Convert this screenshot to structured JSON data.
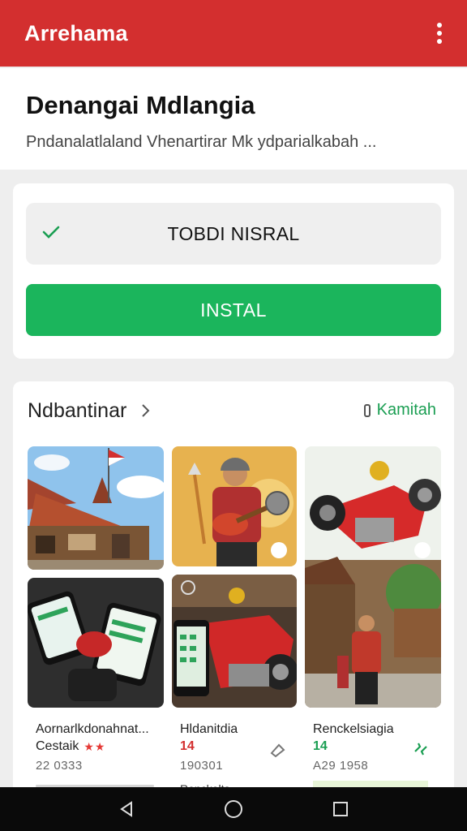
{
  "appbar": {
    "title": "Arrehama",
    "menu_icon": "more-vert-icon",
    "color": "#d32f2f"
  },
  "header": {
    "title": "Denangai Mdlangia",
    "subtitle": "Pndanalatlaland Vhenartirar Mk ydparialkabah ..."
  },
  "install_card": {
    "status_icon": "check-icon",
    "status_text": "TOBDI NISRAL",
    "install_label": "INSTAL",
    "install_color": "#1bb55c"
  },
  "gallery": {
    "title": "Ndbantinar",
    "see_more": "Kamitah",
    "items": [
      {
        "name": "Aornarlkdonahnat...",
        "subtitle": "Cestaik",
        "rating_stars": "★★",
        "number": "22 0333"
      },
      {
        "name": "Hldanitdia",
        "subtitle": "14",
        "number": "190301"
      },
      {
        "name": "Renckelsiagia",
        "subtitle": "14",
        "number": "A29 1958"
      }
    ],
    "peek_text": "Renckelts"
  },
  "navbar": {
    "back_icon": "back-triangle-icon",
    "home_icon": "home-circle-icon",
    "recents_icon": "recents-square-icon"
  }
}
